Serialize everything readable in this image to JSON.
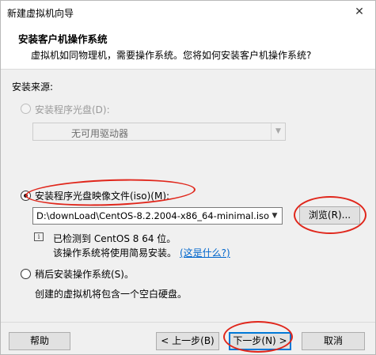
{
  "window": {
    "title": "新建虚拟机向导",
    "close_symbol": "✕"
  },
  "header": {
    "title": "安装客户机操作系统",
    "subtitle": "虚拟机如同物理机，需要操作系统。您将如何安装客户机操作系统?"
  },
  "source_label": "安装来源:",
  "options": {
    "disc": {
      "label": "安装程序光盘(D):",
      "enabled": false,
      "selected": false
    },
    "disc_combo": {
      "value": "无可用驱动器"
    },
    "iso": {
      "label": "安装程序光盘映像文件(iso)(M):",
      "selected": true
    },
    "iso_path": {
      "value": "D:\\downLoad\\CentOS-8.2.2004-x86_64-minimal.iso"
    },
    "browse_label": "浏览(R)...",
    "detected_text": "已检测到 CentOS 8 64 位。",
    "easy_install_text": "该操作系统将使用简易安装。",
    "what_is_this_link": "(这是什么?)",
    "later": {
      "label": "稍后安装操作系统(S)。",
      "selected": false
    },
    "later_desc": "创建的虚拟机将包含一个空白硬盘。"
  },
  "footer": {
    "help_label": "帮助",
    "back_label": "< 上一步(B)",
    "next_label": "下一步(N) >",
    "cancel_label": "取消"
  },
  "icons": {
    "info": "info-icon",
    "dropdown": "chevron-down-icon"
  },
  "colors": {
    "annotation": "#e0261b",
    "link": "#0066cc",
    "focus": "#0078d7"
  }
}
